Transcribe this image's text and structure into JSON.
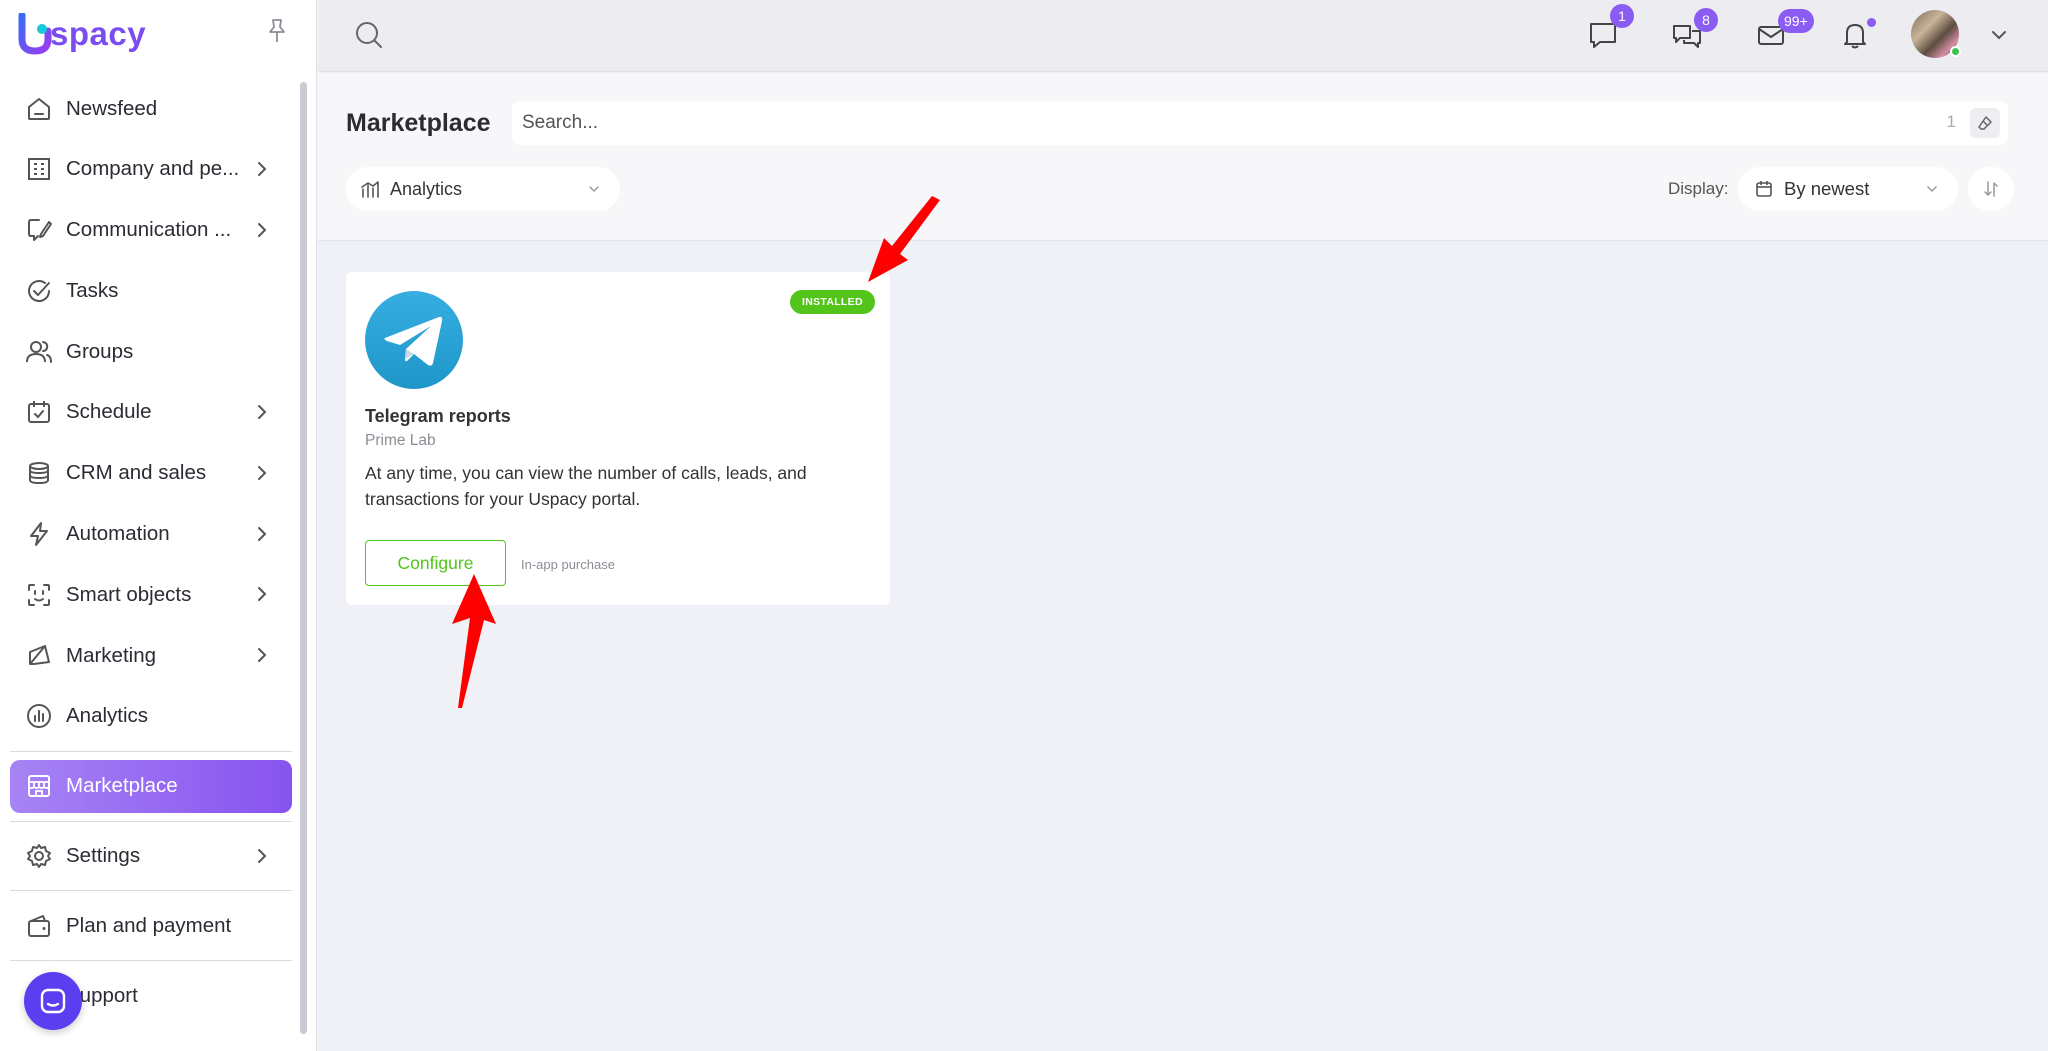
{
  "app": {
    "logo_text": "spacy",
    "logo_letter": "U"
  },
  "sidebar": {
    "items": [
      {
        "label": "Newsfeed",
        "icon": "home-icon",
        "has_submenu": false
      },
      {
        "label": "Company and pe...",
        "icon": "building-icon",
        "has_submenu": true
      },
      {
        "label": "Communication ...",
        "icon": "chat-pen-icon",
        "has_submenu": true
      },
      {
        "label": "Tasks",
        "icon": "check-circle-icon",
        "has_submenu": false
      },
      {
        "label": "Groups",
        "icon": "users-icon",
        "has_submenu": false
      },
      {
        "label": "Schedule",
        "icon": "calendar-check-icon",
        "has_submenu": true
      },
      {
        "label": "CRM and sales",
        "icon": "coins-stack-icon",
        "has_submenu": true
      },
      {
        "label": "Automation",
        "icon": "lightning-icon",
        "has_submenu": true
      },
      {
        "label": "Smart objects",
        "icon": "scan-face-icon",
        "has_submenu": true
      },
      {
        "label": "Marketing",
        "icon": "megaphone-icon",
        "has_submenu": true
      },
      {
        "label": "Analytics",
        "icon": "chart-circle-icon",
        "has_submenu": false
      },
      {
        "label": "Marketplace",
        "icon": "store-icon",
        "has_submenu": false,
        "active": true
      },
      {
        "label": "Settings",
        "icon": "gear-icon",
        "has_submenu": true
      },
      {
        "label": "Plan and payment",
        "icon": "wallet-icon",
        "has_submenu": false
      },
      {
        "label": "Support",
        "icon": "headset-icon",
        "has_submenu": false
      }
    ]
  },
  "topbar": {
    "chat_badge": "1",
    "messages_badge": "8",
    "mail_badge": "99+"
  },
  "header": {
    "title": "Marketplace",
    "search_placeholder": "Search...",
    "search_count": "1",
    "category": "Analytics",
    "display_label": "Display:",
    "sort": "By newest"
  },
  "app_card": {
    "status": "INSTALLED",
    "title": "Telegram reports",
    "vendor": "Prime Lab",
    "description": "At any time, you can view the number of calls, leads, and transactions for your Uspacy portal.",
    "button": "Configure",
    "pricing_note": "In-app purchase"
  },
  "colors": {
    "accent": "#8753f0",
    "success": "#52c41a",
    "telegram": "#2ea6da",
    "annotation_arrow": "#ff0000"
  }
}
